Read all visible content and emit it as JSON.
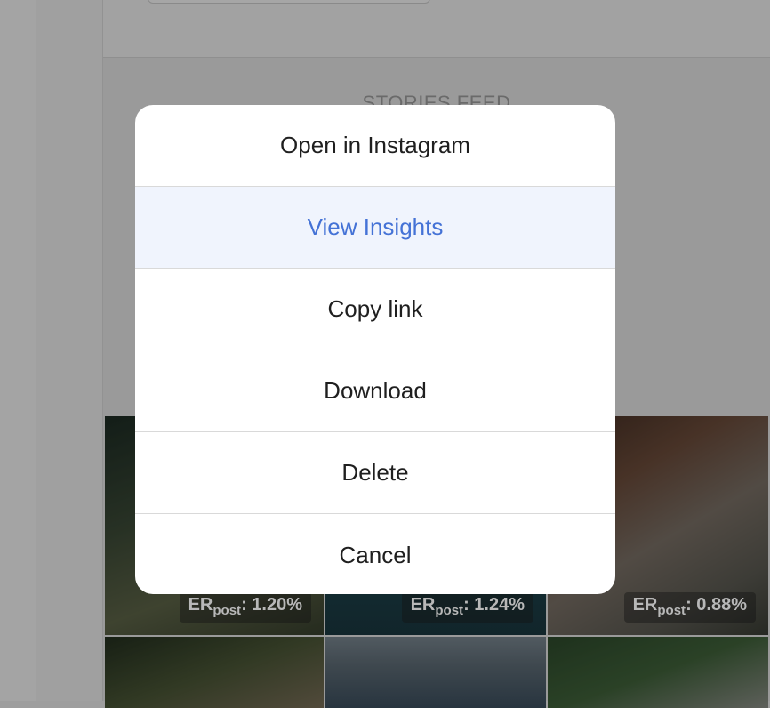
{
  "background": {
    "section_title": "STORIES FEED",
    "posts": [
      {
        "er_label": "ER",
        "er_sub": "post",
        "er_value": ": 1.20%"
      },
      {
        "er_label": "ER",
        "er_sub": "post",
        "er_value": ": 1.24%"
      },
      {
        "er_label": "ER",
        "er_sub": "post",
        "er_value": ": 0.88%"
      }
    ]
  },
  "action_sheet": {
    "items": [
      {
        "label": "Open in Instagram",
        "state": "normal"
      },
      {
        "label": "View Insights",
        "state": "highlighted"
      },
      {
        "label": "Copy link",
        "state": "normal"
      },
      {
        "label": "Download",
        "state": "normal"
      },
      {
        "label": "Delete",
        "state": "normal"
      },
      {
        "label": "Cancel",
        "state": "normal"
      }
    ]
  },
  "colors": {
    "accent": "#4472d6",
    "highlight_bg": "#f0f4fd",
    "overlay": "#9e9e9e"
  }
}
